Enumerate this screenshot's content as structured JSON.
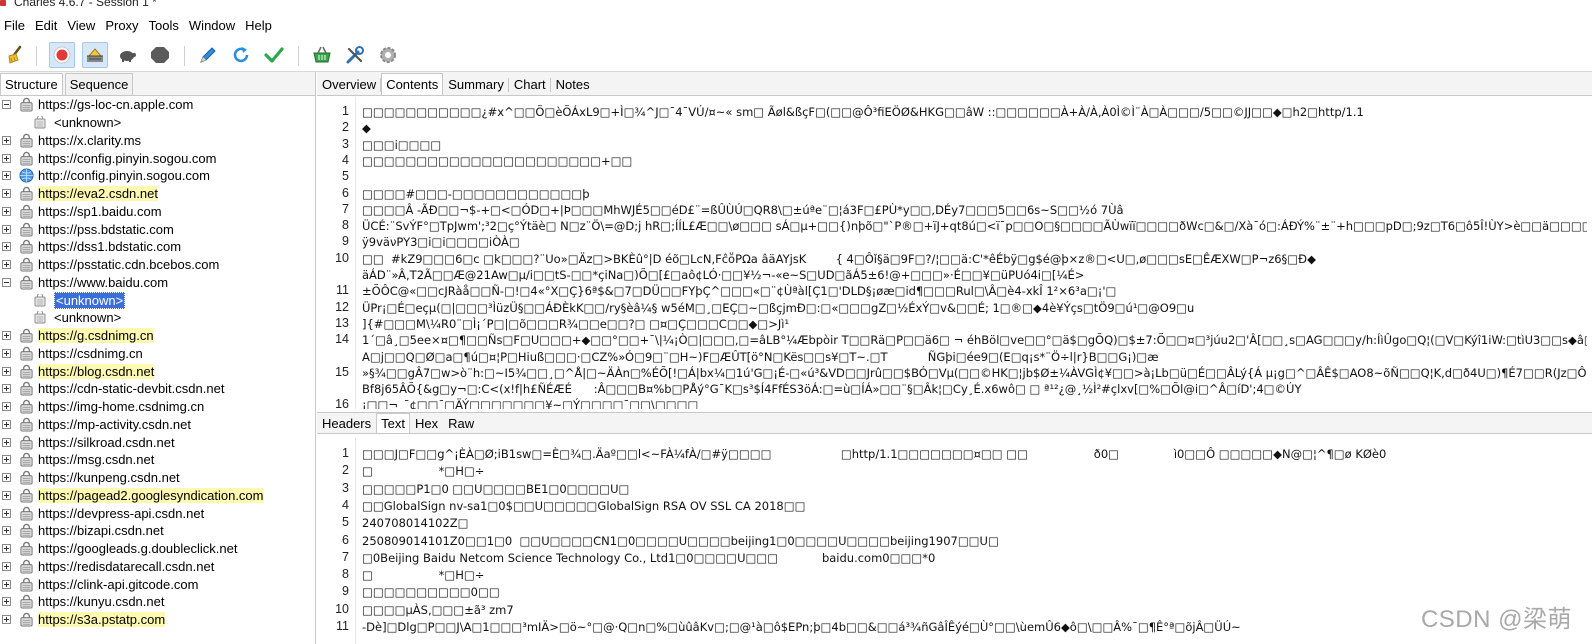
{
  "window": {
    "title": "Charles 4.6.7 - Session 1 *"
  },
  "menu": [
    "File",
    "Edit",
    "View",
    "Proxy",
    "Tools",
    "Window",
    "Help"
  ],
  "toolbar": {
    "buttons": [
      "broom-icon",
      "record-icon",
      "throttle-icon",
      "turtle-icon",
      "breakpoint-icon",
      "pen-icon",
      "refresh-icon",
      "check-icon",
      "basket-icon",
      "tools-icon",
      "settings-icon"
    ],
    "colors": {
      "record": "#e23a3a",
      "accent": "#2a8de0",
      "check": "#2aa84a"
    }
  },
  "left_tabs": [
    "Structure",
    "Sequence"
  ],
  "tree": [
    {
      "label": "https://gs-loc-cn.apple.com",
      "expanded": true,
      "highlight": false,
      "children": [
        {
          "label": "<unknown>",
          "selected": false
        }
      ]
    },
    {
      "label": "https://x.clarity.ms",
      "expanded": false,
      "highlight": false
    },
    {
      "label": "https://config.pinyin.sogou.com",
      "expanded": false,
      "highlight": false
    },
    {
      "label": "http://config.pinyin.sogou.com",
      "expanded": false,
      "highlight": false,
      "icon": "globe"
    },
    {
      "label": "https://eva2.csdn.net",
      "expanded": false,
      "highlight": true
    },
    {
      "label": "https://sp1.baidu.com",
      "expanded": false,
      "highlight": false
    },
    {
      "label": "https://pss.bdstatic.com",
      "expanded": false,
      "highlight": false
    },
    {
      "label": "https://dss1.bdstatic.com",
      "expanded": false,
      "highlight": false
    },
    {
      "label": "https://psstatic.cdn.bcebos.com",
      "expanded": false,
      "highlight": false
    },
    {
      "label": "https://www.baidu.com",
      "expanded": true,
      "highlight": false,
      "children": [
        {
          "label": "<unknown>",
          "selected": true
        },
        {
          "label": "<unknown>",
          "selected": false
        }
      ]
    },
    {
      "label": "https://g.csdnimg.cn",
      "expanded": false,
      "highlight": true
    },
    {
      "label": "https://csdnimg.cn",
      "expanded": false,
      "highlight": false
    },
    {
      "label": "https://blog.csdn.net",
      "expanded": false,
      "highlight": true
    },
    {
      "label": "https://cdn-static-devbit.csdn.net",
      "expanded": false,
      "highlight": false
    },
    {
      "label": "https://img-home.csdnimg.cn",
      "expanded": false,
      "highlight": false
    },
    {
      "label": "https://mp-activity.csdn.net",
      "expanded": false,
      "highlight": false
    },
    {
      "label": "https://silkroad.csdn.net",
      "expanded": false,
      "highlight": false
    },
    {
      "label": "https://msg.csdn.net",
      "expanded": false,
      "highlight": false
    },
    {
      "label": "https://kunpeng.csdn.net",
      "expanded": false,
      "highlight": false
    },
    {
      "label": "https://pagead2.googlesyndication.com",
      "expanded": false,
      "highlight": true
    },
    {
      "label": "https://devpress-api.csdn.net",
      "expanded": false,
      "highlight": false
    },
    {
      "label": "https://bizapi.csdn.net",
      "expanded": false,
      "highlight": false
    },
    {
      "label": "https://googleads.g.doubleclick.net",
      "expanded": false,
      "highlight": false
    },
    {
      "label": "https://redisdatarecall.csdn.net",
      "expanded": false,
      "highlight": false
    },
    {
      "label": "https://clink-api.gitcode.com",
      "expanded": false,
      "highlight": false
    },
    {
      "label": "https://kunyu.csdn.net",
      "expanded": false,
      "highlight": false
    },
    {
      "label": "https://s3a.pstatp.com",
      "expanded": false,
      "highlight": true
    }
  ],
  "right_tabs": [
    "Overview",
    "Contents",
    "Summary",
    "Chart",
    "Notes"
  ],
  "right_selected_tab": "Contents",
  "request_lines": [
    {
      "n": "1",
      "t": "□□□□□□□□□□□¿#x^□□Õ□èÕÁxL9□+Ì□¾^J□¯4¯VÚ/¤~« sm□ Ãøl&ßçF□(□□@Ô³fiEÖØ&HKG□□âW ::□□□□□□À+À/À,À0Ì©Ì¨À□À□□□/5□□©JJ□□◆□h2□http/1.1"
    },
    {
      "n": "2",
      "t": "◆"
    },
    {
      "n": "3",
      "t": "□□□i□□□□"
    },
    {
      "n": "4",
      "t": "□□□□□□□□□□□□□□□□□□□□□□+□□"
    },
    {
      "n": "5",
      "t": ""
    },
    {
      "n": "6",
      "t": "□□□□#□□□-□□□□□□□□□□□□þ"
    },
    {
      "n": "7",
      "t": "□□□□Â -ÃÐ□□¬$-+□<□ÓD□+|Þ□□□MhWJÉ5□□éD£¨=ßÛÙÚ□QR8\\□±úªe¨□¦á3F□£PÙ*y□□,DÉy7□□□5□□6s~S□□½ó 7Ùâ"
    },
    {
      "n": "8",
      "t": "ÜCÉ:¨SvÝF°□TpJwm';³2□ç°Ýtäè□ N□z¨Ö\\=@D;j hR□;ÍÍL£Æ□□\\ø□□□ sÁ□µ+□□{)nþõ□\"`P®□+ïJ+qt8ú□<ï¯p□□O□§□□□□ÃÙwïï□□□□ðWc□&□/Xà¯ó□:ÁÐÝ%¨±¨+h□□□pD□;9z□T6□ô5Î!ÙY>è□□ä□□□□(®¨ô,□□ÁÐF□□□ü"
    },
    {
      "n": "9",
      "t": "ÿ9väνPY3□i□i□□□□iÒÀ□"
    },
    {
      "n": "10",
      "t": "□□  #kZ9□□□6□c □k□□□?¨Uo»□Äz□>BKÈû°|D éõ□LcN,FĉṏPΩa âäAYjsK        { 4□Ôǐ§ä□9F□?/¦□□ä:C'*êÉbÿ□g$é@þ×z®□<U□,ø□□□sE□ÊÆXW□P¬z6§□Ð◆"
    },
    {
      "n": "10b",
      "t": "äÁD¨»Â,T2Ã□□Æ@21Aw□µ/i□□tS-□□*çiNa□)Õ□[£□aô¢LÓ·□□¥½¬-«e~S□UD□ãÁ5±6!@+□□□»·É□□¥□üPUó4i□[¼É>"
    },
    {
      "n": "11",
      "t": "±ÕÔC@«□□cJRàå□□Ñ-□!□4«°X□Ç}6ª$&□7□DÜ□□FYþÇ^□□□«□¨¢Ùªàl[Ç1□'DLD§¡øæ□id¶□□□Rul□\\Â□è4-xkÎ 1²×6³a□¡'□"
    },
    {
      "n": "12",
      "t": "ÜPr¡□É□eçµ(□|□□□³ÌüzÜ§□□ÁÐÈkK□□/ry§èâ¼§ w5éM□¸□EÇ□~□ßçjmÐ□:□«□□□gZ□½ÉxÝ□v&□□É; 1□®□◆4è¥Ýçs□tÖ9□ú¹□@O9□u"
    },
    {
      "n": "13",
      "t": "]{#□□□M\\¼R0¨□Ì¡´P□|□õ□□□R¾□□e□□?□ □¤□Ç□□□C□□◆□>Jì¹"
    },
    {
      "n": "14",
      "t": "1´□â¸□5ee×¤□¶□□Ñs□F□U□□□+◆□□°□□+¯\\|¼¡Ò□|□□□,□=âLB°¼Æbpòir T□□Rä□P□□ä6□ ¬ éhBöl□ve□□°□ä$□gÕQ)□$±7:Õ□□¤□³júu2□'Â[□□¸s□AG□□□y/h:ÍìÛgo□Q¦(□V□Kýî1iW:□tìU3□□s◆â□É□□áw□+□è46Ë¼uu□"
    },
    {
      "n": "14b",
      "t": "A□j□□Q□Ø□a□¶ú□¤¦P□Hiuß□□□·□CZ%»Ó□9□¨□H~)F□ÆÛT[ö°N□Kës□□s¥□T~.□T           ÑGþi□ée9□(E□q¡s*¨Ö÷l|r}B□□G¡)□æ"
    },
    {
      "n": "15",
      "t": "»§¾□□gÂ7□w>ò¨h:□~I5¾□□¸□^Å|□~ÄÀn□%ÉÕ[!□Á|bx¼□1ú'G□¡É-□«ú³&VD□□Jrû□□$BÓ□Vµ(□□©HK□¦jb$Ø±¼ÀVGÌ¢¥□□>à¡Lb□ü□É□□ÂLý{Á µ¡g□^□ÂÊ$□AO8~õÑ□□Q¦K,d□ð4U□)¶É7□□R(Jz□Ô°S4□□□$Õ¸□BQ□□"
    },
    {
      "n": "15b",
      "t": "Bf8j65ÂÕ{&g□y¬□:C<(x!f|h£ÑÉÆÉ      :Â□□□B¤%b□PÅý°G¯K□s³$Í4FfÉS3öÁ:□=ù□ÍÁ»□□¨§□Âk¦□Cy¸É.x6wô□ □ ª¹²¿@¸½Ì²#çlxv[□%□Õl@i□^Â□íD';4□©ÚY"
    },
    {
      "n": "16",
      "t": "¡□□¬¸¯¢□□¯□ÄÝ□□□□□□□¥~□Ý□□□□¯□□\\□□□□"
    }
  ],
  "bottom_tabs": [
    "Headers",
    "Text",
    "Hex",
    "Raw"
  ],
  "bottom_selected_tab": "Text",
  "response_lines": [
    {
      "n": "1",
      "t": "□□□J□F□□g^¡ÈÀ□Ø;iB1sw□=È□¾□.Äaº□□l<~FÀ¼fÀ/□#ÿ□□□□                   □http/1.1□□□□□□□¤□□ □□                  ð0□               ì0□□Ô □□□□□◆N@□¦^¶□ø KØè0"
    },
    {
      "n": "2",
      "t": "□                  *□H□÷"
    },
    {
      "n": "3",
      "t": "□□□□□P1□0 □□U□□□□BE1□0□□□□U□"
    },
    {
      "n": "4",
      "t": "□□GlobalSign nv-sa1□0$□□U□□□□□GlobalSign RSA OV SSL CA 2018□□"
    },
    {
      "n": "5",
      "t": "240708014102Z□"
    },
    {
      "n": "6",
      "t": "250809014101Z0□□1□0  □□U□□□□CN1□0□□□□U□□□□beijing1□0□□□□U□□□□beijing1907□□U□"
    },
    {
      "n": "7",
      "t": "□0Beijing Baidu Netcom Science Technology Co., Ltd1□0□□□□U□□□            baidu.com0□□□*0"
    },
    {
      "n": "8",
      "t": "□                  *□H□÷"
    },
    {
      "n": "9",
      "t": "□□□□□□□□□□0□□"
    },
    {
      "n": "10",
      "t": "□□□□µÀS,□□□±ã³ zm7"
    },
    {
      "n": "11",
      "t": "-Dè]□Dlg□P□□J\\A□1□□□³mIÄ>□ö~°□@·Q□n□%□ùûâKv□;□@¹à□ô$EPn;þ□4b□□&□□á³¾ñGâÎÊýé□Ù°□□\\ùemÛ6◆ô□\\□□Â%¯□¶Ê°ª□õjÂ□ÜÚ~"
    }
  ],
  "watermark": "CSDN @梁萌"
}
